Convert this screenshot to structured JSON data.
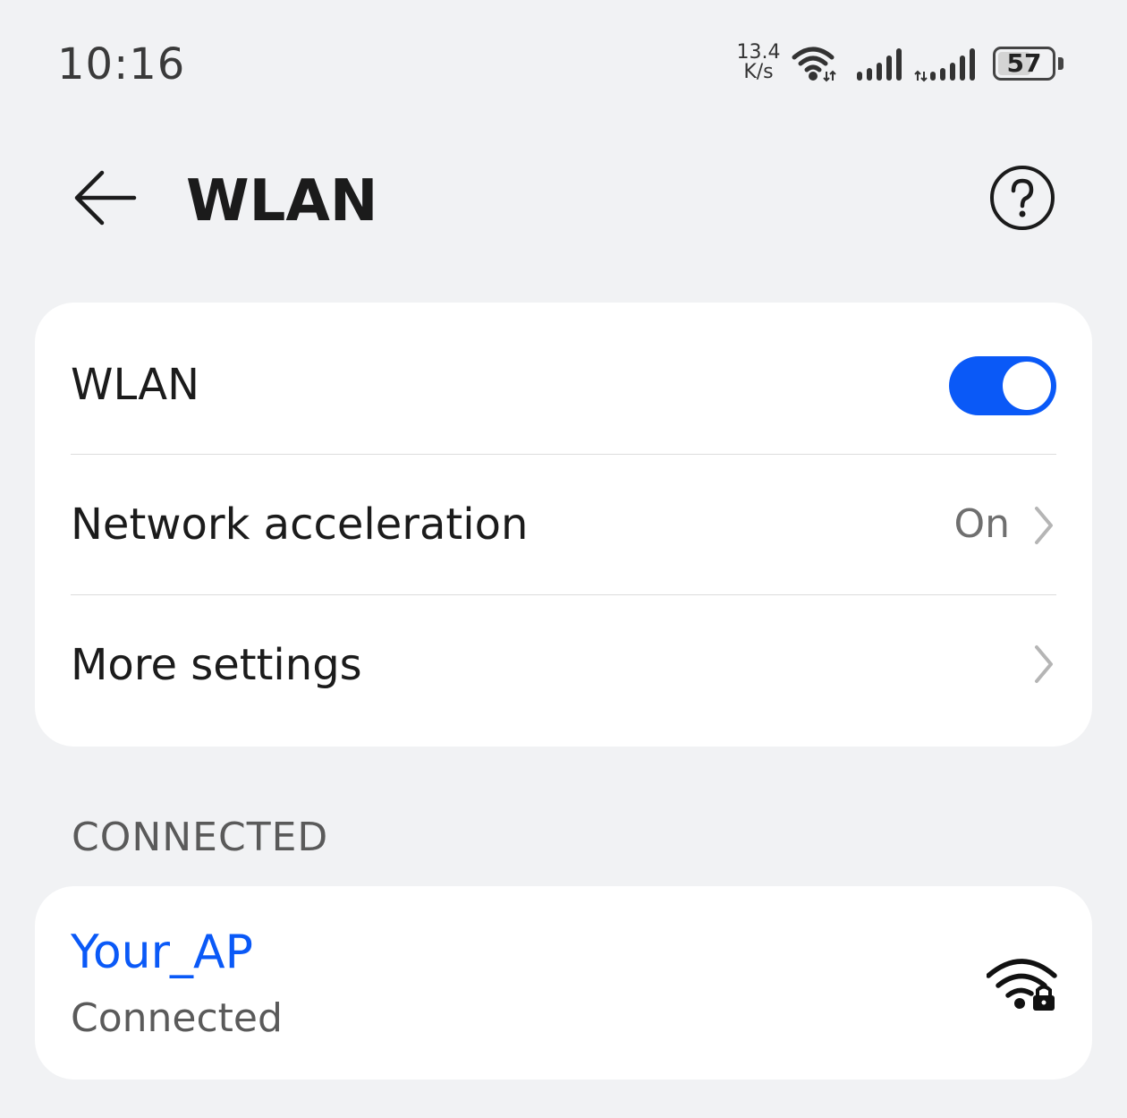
{
  "status_bar": {
    "time": "10:16",
    "speed_value": "13.4",
    "speed_unit": "K/s",
    "battery": "57",
    "icons": [
      "wifi-icon",
      "signal-icon",
      "signal-icon",
      "battery-icon"
    ]
  },
  "header": {
    "title": "WLAN",
    "back_icon": "back-arrow-icon",
    "help_icon": "help-icon"
  },
  "settings": {
    "wlan_label": "WLAN",
    "wlan_enabled": true,
    "network_acceleration_label": "Network acceleration",
    "network_acceleration_value": "On",
    "more_settings_label": "More settings"
  },
  "connected_section": {
    "header": "CONNECTED",
    "network": {
      "name": "Your_AP",
      "status": "Connected",
      "icon": "wifi-lock-icon"
    }
  },
  "colors": {
    "accent": "#0a59f7",
    "background": "#f1f2f4",
    "card": "#ffffff"
  }
}
